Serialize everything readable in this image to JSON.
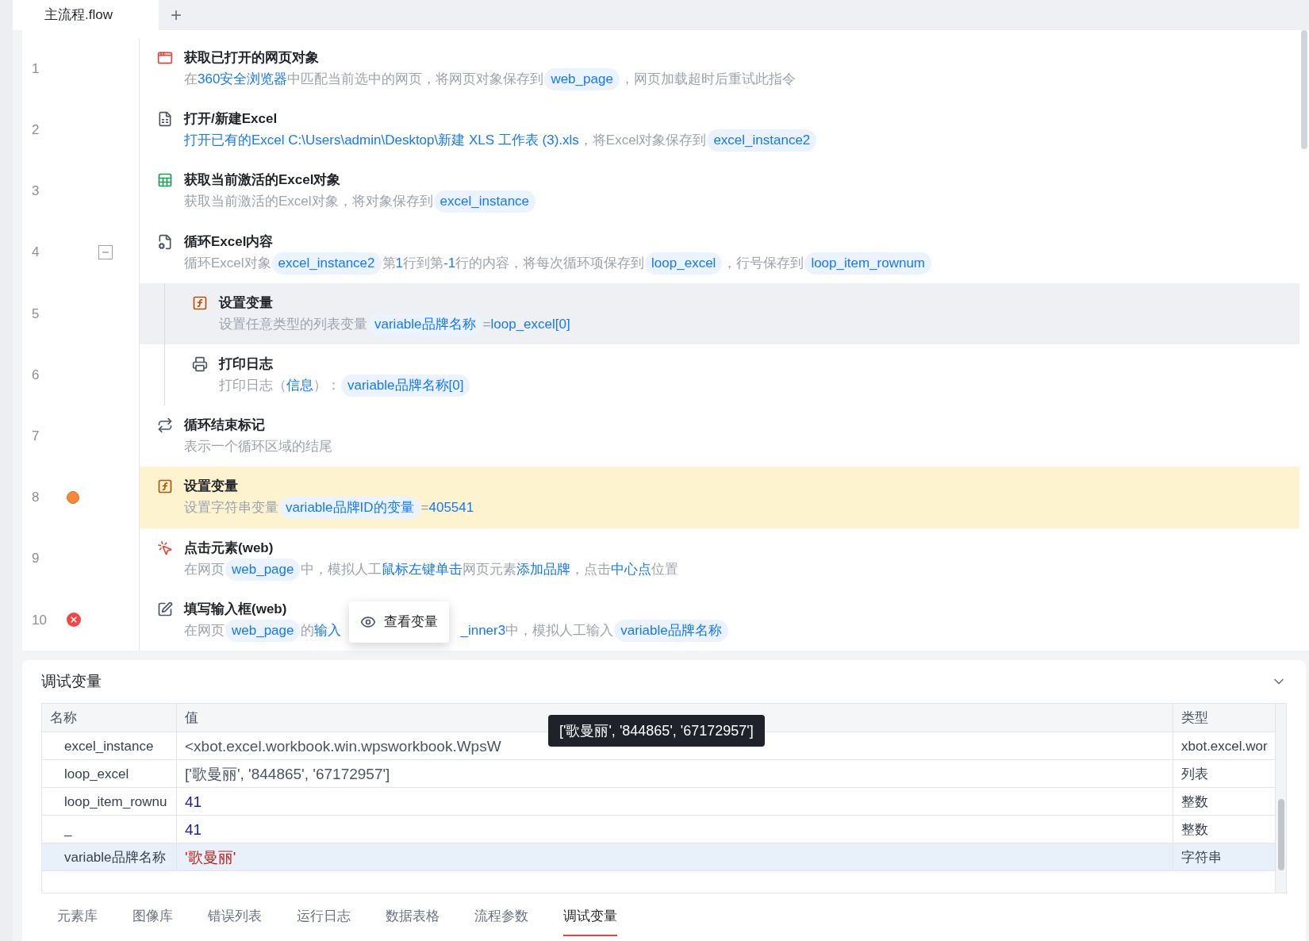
{
  "tabs": [
    {
      "label": "主流程.flow",
      "selected": true
    }
  ],
  "new_tab": "+",
  "steps": [
    {
      "number": "1",
      "kind": "browser",
      "title": "获取已打开的网页对象",
      "breakpoint": false,
      "error": false,
      "selected": false,
      "current": false,
      "description": [
        {
          "kind": "text",
          "text": "在"
        },
        {
          "kind": "accent",
          "text": "360安全浏览器"
        },
        {
          "kind": "text",
          "text": "中匹配当前选中的网页，将网页对象保存到"
        },
        {
          "kind": "pill",
          "text": "web_page"
        },
        {
          "kind": "text",
          "text": "，网页加载超时后重试此指令"
        }
      ]
    },
    {
      "number": "2",
      "kind": "excel-open",
      "title": "打开/新建Excel",
      "breakpoint": false,
      "error": false,
      "selected": false,
      "current": false,
      "description": [
        {
          "kind": "accent",
          "text": "打开已有的Excel C:\\Users\\admin\\Desktop\\新建 XLS 工作表 (3).xls"
        },
        {
          "kind": "text",
          "text": "，将Excel对象保存到"
        },
        {
          "kind": "pill",
          "text": "excel_instance2"
        }
      ]
    },
    {
      "number": "3",
      "kind": "excel-active",
      "title": "获取当前激活的Excel对象",
      "breakpoint": false,
      "error": false,
      "selected": false,
      "current": false,
      "description": [
        {
          "kind": "text",
          "text": "获取当前激活的Excel对象，将对象保存到"
        },
        {
          "kind": "pill",
          "text": "excel_instance"
        }
      ]
    },
    {
      "number": "4",
      "kind": "excel-loop",
      "title": "循环Excel内容",
      "breakpoint": false,
      "error": false,
      "selected": false,
      "current": false,
      "expanded": true,
      "description": [
        {
          "kind": "text",
          "text": "循环Excel对象"
        },
        {
          "kind": "pill",
          "text": "excel_instance2"
        },
        {
          "kind": "text",
          "text": "第"
        },
        {
          "kind": "accent",
          "text": "1"
        },
        {
          "kind": "text",
          "text": "行到第"
        },
        {
          "kind": "accent",
          "text": "-1"
        },
        {
          "kind": "text",
          "text": "行的内容，将每次循环项保存到"
        },
        {
          "kind": "pill",
          "text": "loop_excel"
        },
        {
          "kind": "text",
          "text": "，行号保存到"
        },
        {
          "kind": "pill",
          "text": "loop_item_rownum"
        }
      ],
      "children": [
        {
          "number": "5",
          "kind": "fx",
          "title": "设置变量",
          "breakpoint": false,
          "error": false,
          "selected": true,
          "current": false,
          "description": [
            {
              "kind": "text",
              "text": "设置任意类型的列表变量"
            },
            {
              "kind": "pill",
              "text": "variable品牌名称"
            },
            {
              "kind": "text",
              "text": " ="
            },
            {
              "kind": "accent",
              "text": "loop_excel[0]"
            }
          ]
        },
        {
          "number": "6",
          "kind": "printer",
          "title": "打印日志",
          "breakpoint": false,
          "error": false,
          "selected": false,
          "current": false,
          "description": [
            {
              "kind": "text",
              "text": "打印日志（"
            },
            {
              "kind": "accent",
              "text": "信息"
            },
            {
              "kind": "text",
              "text": "）："
            },
            {
              "kind": "pill",
              "text": "variable品牌名称[0]"
            }
          ]
        }
      ]
    },
    {
      "number": "7",
      "kind": "loop-end",
      "title": "循环结束标记",
      "breakpoint": false,
      "error": false,
      "selected": false,
      "current": false,
      "description": [
        {
          "kind": "text",
          "text": "表示一个循环区域的结尾"
        }
      ]
    },
    {
      "number": "8",
      "kind": "fx",
      "title": "设置变量",
      "breakpoint": true,
      "error": false,
      "selected": false,
      "current": true,
      "description": [
        {
          "kind": "text",
          "text": "设置字符串变量"
        },
        {
          "kind": "pill",
          "text": "variable品牌ID的变量"
        },
        {
          "kind": "text",
          "text": "="
        },
        {
          "kind": "accent",
          "text": "405541"
        }
      ]
    },
    {
      "number": "9",
      "kind": "click",
      "title": "点击元素(web)",
      "breakpoint": false,
      "error": false,
      "selected": false,
      "current": false,
      "description": [
        {
          "kind": "text",
          "text": "在网页"
        },
        {
          "kind": "pill",
          "text": "web_page"
        },
        {
          "kind": "text",
          "text": "中，模拟人工"
        },
        {
          "kind": "accent",
          "text": "鼠标左键单击"
        },
        {
          "kind": "text",
          "text": "网页元素"
        },
        {
          "kind": "accent",
          "text": "添加品牌"
        },
        {
          "kind": "text",
          "text": "，点击"
        },
        {
          "kind": "accent",
          "text": "中心点"
        },
        {
          "kind": "text",
          "text": "位置"
        }
      ]
    },
    {
      "number": "10",
      "kind": "input",
      "title": "填写输入框(web)",
      "breakpoint": false,
      "error": true,
      "selected": false,
      "current": false,
      "description": [
        {
          "kind": "text",
          "text": "在网页"
        },
        {
          "kind": "pill",
          "text": "web_page"
        },
        {
          "kind": "text",
          "text": "的"
        },
        {
          "kind": "accent",
          "text": "输入"
        },
        {
          "kind": "gap"
        },
        {
          "kind": "accent",
          "text": "_inner3"
        },
        {
          "kind": "text",
          "text": "中，模拟人工输入"
        },
        {
          "kind": "pill",
          "text": "variable品牌名称"
        }
      ]
    }
  ],
  "context_menu": {
    "label": "查看变量"
  },
  "debug_panel": {
    "title": "调试变量",
    "columns": [
      "名称",
      "值",
      "类型"
    ],
    "rows": [
      {
        "name": "excel_instance",
        "value": "<xbot.excel.workbook.win.wpsworkbook.WpsW",
        "kind": "text",
        "type": "xbot.excel.wor",
        "selected": false
      },
      {
        "name": "loop_excel",
        "value": "['歌曼丽', '844865', '67172957']",
        "kind": "text",
        "type": "列表",
        "selected": false
      },
      {
        "name": "loop_item_rownu",
        "value": "41",
        "kind": "number",
        "type": "整数",
        "selected": false
      },
      {
        "name": "_",
        "value": "41",
        "kind": "number",
        "type": "整数",
        "selected": false
      },
      {
        "name": "variable品牌名称",
        "value": "'歌曼丽'",
        "kind": "string",
        "type": "字符串",
        "selected": true
      }
    ],
    "tooltip": "['歌曼丽', '844865', '67172957']"
  },
  "bottom_tabs": [
    {
      "label": "元素库",
      "selected": false
    },
    {
      "label": "图像库",
      "selected": false
    },
    {
      "label": "错误列表",
      "selected": false
    },
    {
      "label": "运行日志",
      "selected": false
    },
    {
      "label": "数据表格",
      "selected": false
    },
    {
      "label": "流程参数",
      "selected": false
    },
    {
      "label": "调试变量",
      "selected": true
    }
  ]
}
